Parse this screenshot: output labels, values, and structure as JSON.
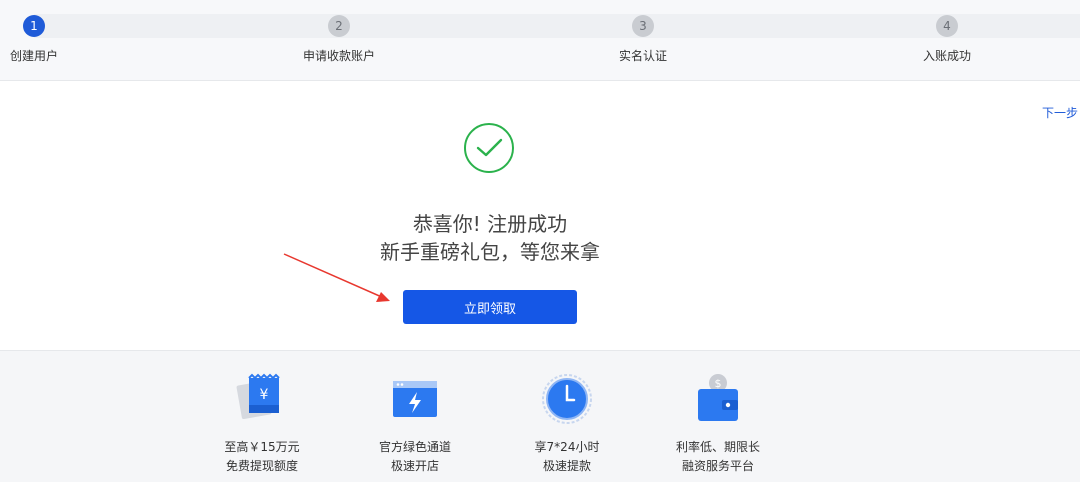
{
  "stepper": {
    "steps": [
      {
        "num": "1",
        "label": "创建用户",
        "active": true
      },
      {
        "num": "2",
        "label": "申请收款账户",
        "active": false
      },
      {
        "num": "3",
        "label": "实名认证",
        "active": false
      },
      {
        "num": "4",
        "label": "入账成功",
        "active": false
      }
    ]
  },
  "header": {
    "next_link": "下一步"
  },
  "success": {
    "title": "恭喜你! 注册成功",
    "subtitle": "新手重磅礼包，等您来拿",
    "button_label": "立即领取"
  },
  "features": [
    {
      "icon": "coupon-yuan-icon",
      "line1": "至高￥15万元",
      "line2": "免费提现额度"
    },
    {
      "icon": "browser-lightning-icon",
      "line1": "官方绿色通道",
      "line2": "极速开店"
    },
    {
      "icon": "clock-icon",
      "line1": "享7*24小时",
      "line2": "极速提款"
    },
    {
      "icon": "wallet-dollar-icon",
      "line1": "利率低、期限长",
      "line2": "融资服务平台"
    }
  ],
  "colors": {
    "accent": "#1557e6",
    "success_green": "#2bb24c",
    "arrow_red": "#e8382f"
  }
}
